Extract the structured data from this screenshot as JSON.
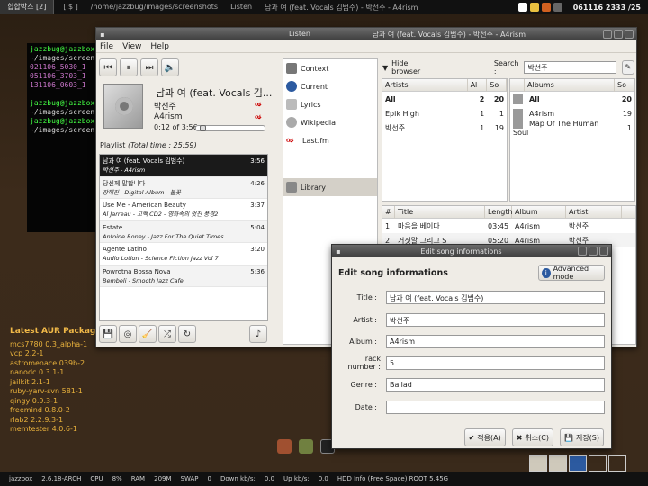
{
  "top_panel": {
    "workspace": "힙합박스 [2]",
    "tasks": [
      "[ $ ]",
      "/home/jazzbug/images/screenshots",
      "Listen",
      "남과 여 (feat. Vocals 김범수) - 박선주 - A4rism"
    ],
    "clock": "061116 2333 /25"
  },
  "terminal": {
    "lines": [
      "jazzbug@jazzbox",
      "~/images/screens",
      "021106_5030_1",
      "051106_3703_1",
      "131106_0603_1",
      "jazzbug@jazzbox",
      "~/images/screens",
      "jazzbug@jazzbox",
      "~/images/screens"
    ]
  },
  "aur": {
    "title": "Latest AUR Packages",
    "items": [
      "mcs7780 0.3_alpha-1",
      "vcp 2.2-1",
      "astromenace 039b-2",
      "nanodc 0.3.1-1",
      "jailkit 2.1-1",
      "ruby-yarv-svn 581-1",
      "qingy 0.9.3-1",
      "freemind 0.8.0-2",
      "rlab2 2.2.9.3-1",
      "memtester 4.0.6-1"
    ]
  },
  "bottom_panel": {
    "host": "jazzbox",
    "kernel": "2.6.18-ARCH",
    "cpu_label": "CPU",
    "cpu": "8%",
    "ram_label": "RAM",
    "ram": "209M",
    "swap_label": "SWAP",
    "swap": "0",
    "down_label": "Down kb/s:",
    "down": "0.0",
    "up_label": "Up kb/s:",
    "up": "0.0",
    "hdd": "HDD Info (Free Space) ROOT 5.45G"
  },
  "window": {
    "title_left": "Listen",
    "title_center": "남과 여 (feat. Vocals 김범수) - 박선주 - A4rism",
    "menu": [
      "File",
      "View",
      "Help"
    ]
  },
  "now_playing": {
    "title": "남과 여 (feat. Vocals 김...",
    "artist": "박선주",
    "album": "A4rism",
    "time": "0:12 of 3:56",
    "lastfm_glyph": "♾",
    "progress": 0.05
  },
  "playlist": {
    "label": "Playlist",
    "total": "(Total time : 25:59)",
    "items": [
      {
        "t1": "남과 여 (feat. Vocals 김범수)",
        "t2": "박선주 - A4rism",
        "dur": "3:56"
      },
      {
        "t1": "당신께 말합니다",
        "t2": "장혜진 - Digital Album - 불꽃",
        "dur": "4:26"
      },
      {
        "t1": "Use Me - American Beauty",
        "t2": "Al Jarreau - 고백 CD2 - 영화속의 멋진 풍경2",
        "dur": "3:37"
      },
      {
        "t1": "Estate",
        "t2": "Antoine Roney - Jazz For The Quiet Times",
        "dur": "5:04"
      },
      {
        "t1": "Agente Latino",
        "t2": "Audio Lotion - Science Fiction Jazz Vol 7",
        "dur": "3:20"
      },
      {
        "t1": "Powrotna Bossa Nova",
        "t2": "Bembeli - Smooth Jazz Cafe",
        "dur": "5:36"
      }
    ]
  },
  "nav": {
    "items": [
      "Context",
      "Current",
      "Lyrics",
      "Wikipedia",
      "Last.fm",
      "Library"
    ],
    "lastfm_glyph": "ℴ𝓈"
  },
  "browser": {
    "hide_label": "Hide browser",
    "search_label": "Search :",
    "search_value": "박선주"
  },
  "artists": {
    "headers": [
      "Artists",
      "Al",
      "So"
    ],
    "rows": [
      [
        "All",
        "2",
        "20"
      ],
      [
        "Epik High",
        "1",
        "1"
      ],
      [
        "박선주",
        "1",
        "19"
      ]
    ]
  },
  "albums": {
    "headers": [
      "Albums",
      "So"
    ],
    "rows": [
      [
        "All",
        "20"
      ],
      [
        "A4rism",
        "19"
      ],
      [
        "Map Of The Human Soul",
        "1"
      ]
    ]
  },
  "tracks": {
    "headers": [
      "#",
      "Title",
      "Length",
      "Album",
      "Artist"
    ],
    "rows": [
      [
        "1",
        "마음을 베이다",
        "03:45",
        "A4rism",
        "박선주"
      ],
      [
        "2",
        "거짓말 그리고 S",
        "05:20",
        "A4rism",
        "박선주"
      ]
    ]
  },
  "dialog": {
    "title": "Edit song informations",
    "heading": "Edit song informations",
    "advanced": "Advanced mode",
    "fields": [
      {
        "label": "Title :",
        "value": "남과 여 (feat. Vocals 김범수)"
      },
      {
        "label": "Artist :",
        "value": "박선주"
      },
      {
        "label": "Album :",
        "value": "A4rism"
      },
      {
        "label": "Track number :",
        "value": "5"
      },
      {
        "label": "Genre :",
        "value": "Ballad"
      },
      {
        "label": "Date :",
        "value": ""
      }
    ],
    "apply": "적용(A)",
    "cancel": "취소(C)",
    "save": "저장(S)"
  }
}
